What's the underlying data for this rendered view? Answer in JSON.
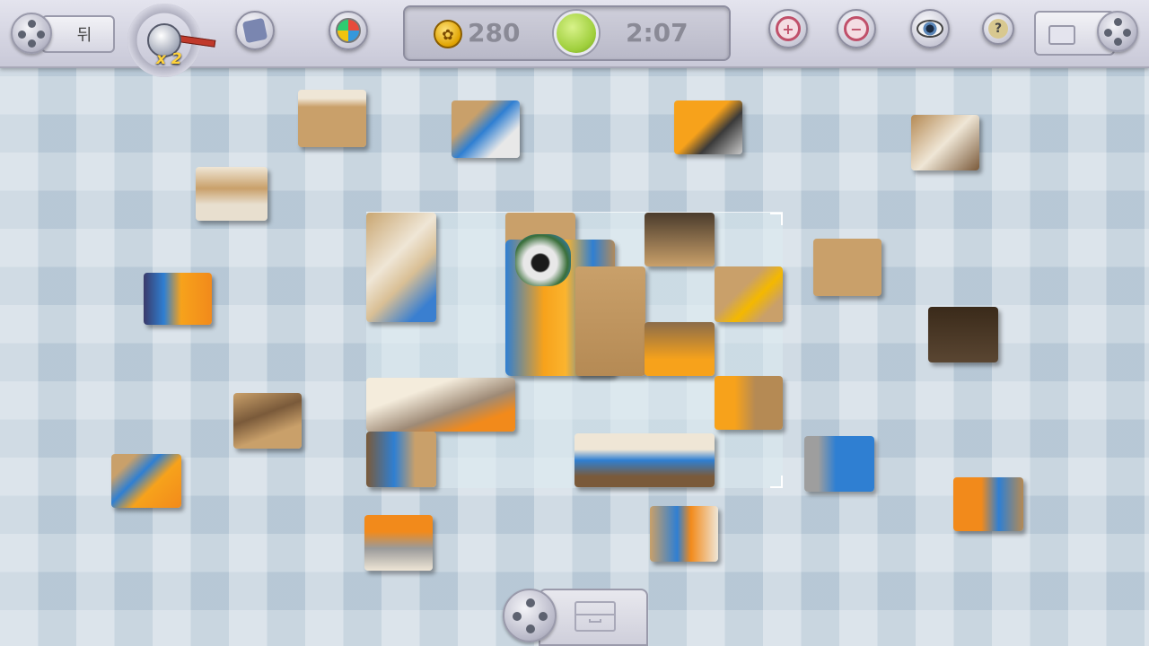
{
  "toolbar": {
    "menu_label": "뒤",
    "multiplier_label": "x 2",
    "help_label": "?"
  },
  "status": {
    "coins": "280",
    "timer": "2:07"
  },
  "colors": {
    "coin": "#e0a300",
    "timer_ball": "#9fcf3c",
    "board_bg": "#dcebf0"
  },
  "icons": {
    "menu": "gear-icon",
    "multiplier": "dial-icon",
    "puzzle_preview": "puzzle-preview-icon",
    "palette": "palette-icon",
    "zoom_in": "zoom-in-icon",
    "zoom_out": "zoom-out-icon",
    "eye": "eye-icon",
    "help": "help-icon",
    "tools": "toolbox-icon",
    "tray": "drawer-icon"
  }
}
